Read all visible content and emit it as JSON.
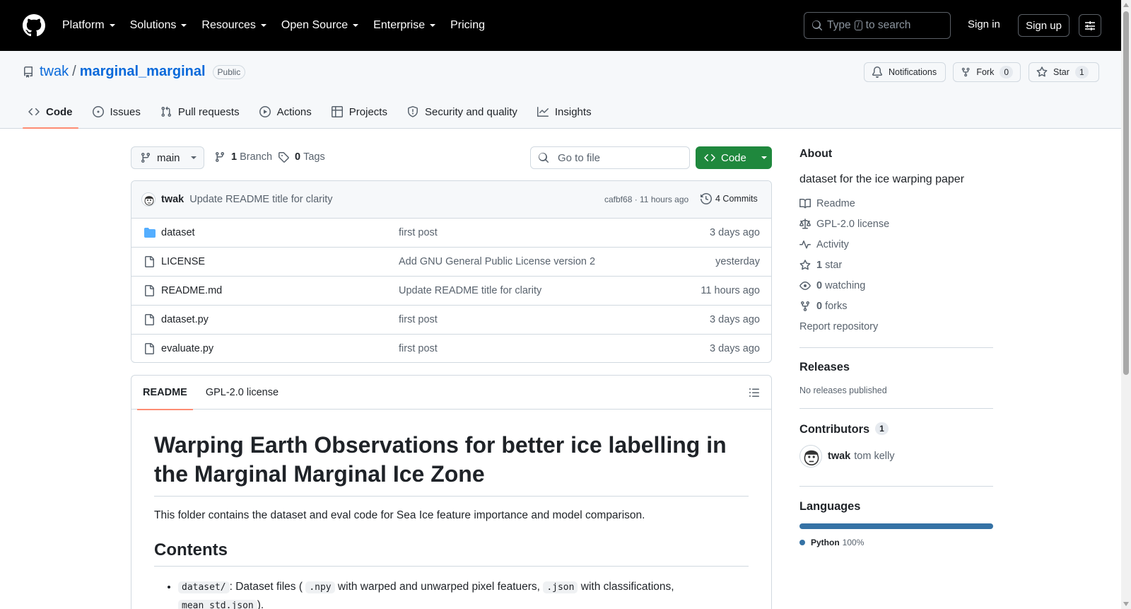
{
  "header": {
    "nav": [
      "Platform",
      "Solutions",
      "Resources",
      "Open Source",
      "Enterprise",
      "Pricing"
    ],
    "search_prefix": "Type",
    "search_key": "/",
    "search_suffix": "to search",
    "sign_in": "Sign in",
    "sign_up": "Sign up"
  },
  "repo": {
    "owner": "twak",
    "name": "marginal_marginal",
    "visibility": "Public",
    "notifications": "Notifications",
    "fork_label": "Fork",
    "fork_count": "0",
    "star_label": "Star",
    "star_count": "1"
  },
  "tabs": [
    "Code",
    "Issues",
    "Pull requests",
    "Actions",
    "Projects",
    "Security and quality",
    "Insights"
  ],
  "toolbar": {
    "branch": "main",
    "branch_count": "1",
    "branch_label": "Branch",
    "tag_count": "0",
    "tag_label": "Tags",
    "goto_placeholder": "Go to file",
    "code_button": "Code"
  },
  "latest_commit": {
    "author": "twak",
    "message": "Update README title for clarity",
    "sha_time": "cafbf68 · 11 hours ago",
    "commits": "4 Commits"
  },
  "files": [
    {
      "name": "dataset",
      "type": "dir",
      "message": "first post",
      "date": "3 days ago"
    },
    {
      "name": "LICENSE",
      "type": "file",
      "message": "Add GNU General Public License version 2",
      "date": "yesterday"
    },
    {
      "name": "README.md",
      "type": "file",
      "message": "Update README title for clarity",
      "date": "11 hours ago"
    },
    {
      "name": "dataset.py",
      "type": "file",
      "message": "first post",
      "date": "3 days ago"
    },
    {
      "name": "evaluate.py",
      "type": "file",
      "message": "first post",
      "date": "3 days ago"
    }
  ],
  "readme": {
    "tab_readme": "README",
    "tab_license": "GPL-2.0 license",
    "title": "Warping Earth Observations for better ice labelling in the Marginal Marginal Ice Zone",
    "intro": "This folder contains the dataset and eval code for Sea Ice feature importance and model comparison.",
    "contents_heading": "Contents",
    "item1": {
      "code1": "dataset/",
      "text1": ": Dataset files (",
      "code2": ".npy",
      "text2": " with warped and unwarped pixel featuers,",
      "code3": ".json",
      "text3": " with classifications,",
      "code4": "mean_std.json",
      "text4": ")."
    }
  },
  "about": {
    "heading": "About",
    "description": "dataset for the ice warping paper",
    "readme": "Readme",
    "license": "GPL-2.0 license",
    "activity": "Activity",
    "stars_count": "1",
    "stars_label": "star",
    "watching_count": "0",
    "watching_label": "watching",
    "forks_count": "0",
    "forks_label": "forks",
    "report": "Report repository"
  },
  "releases": {
    "heading": "Releases",
    "text": "No releases published"
  },
  "contributors": {
    "heading": "Contributors",
    "count": "1",
    "login": "twak",
    "fullname": "tom kelly"
  },
  "languages": {
    "heading": "Languages",
    "name": "Python",
    "percent": "100%",
    "color": "#3572A5",
    "fraction": 1.0
  }
}
